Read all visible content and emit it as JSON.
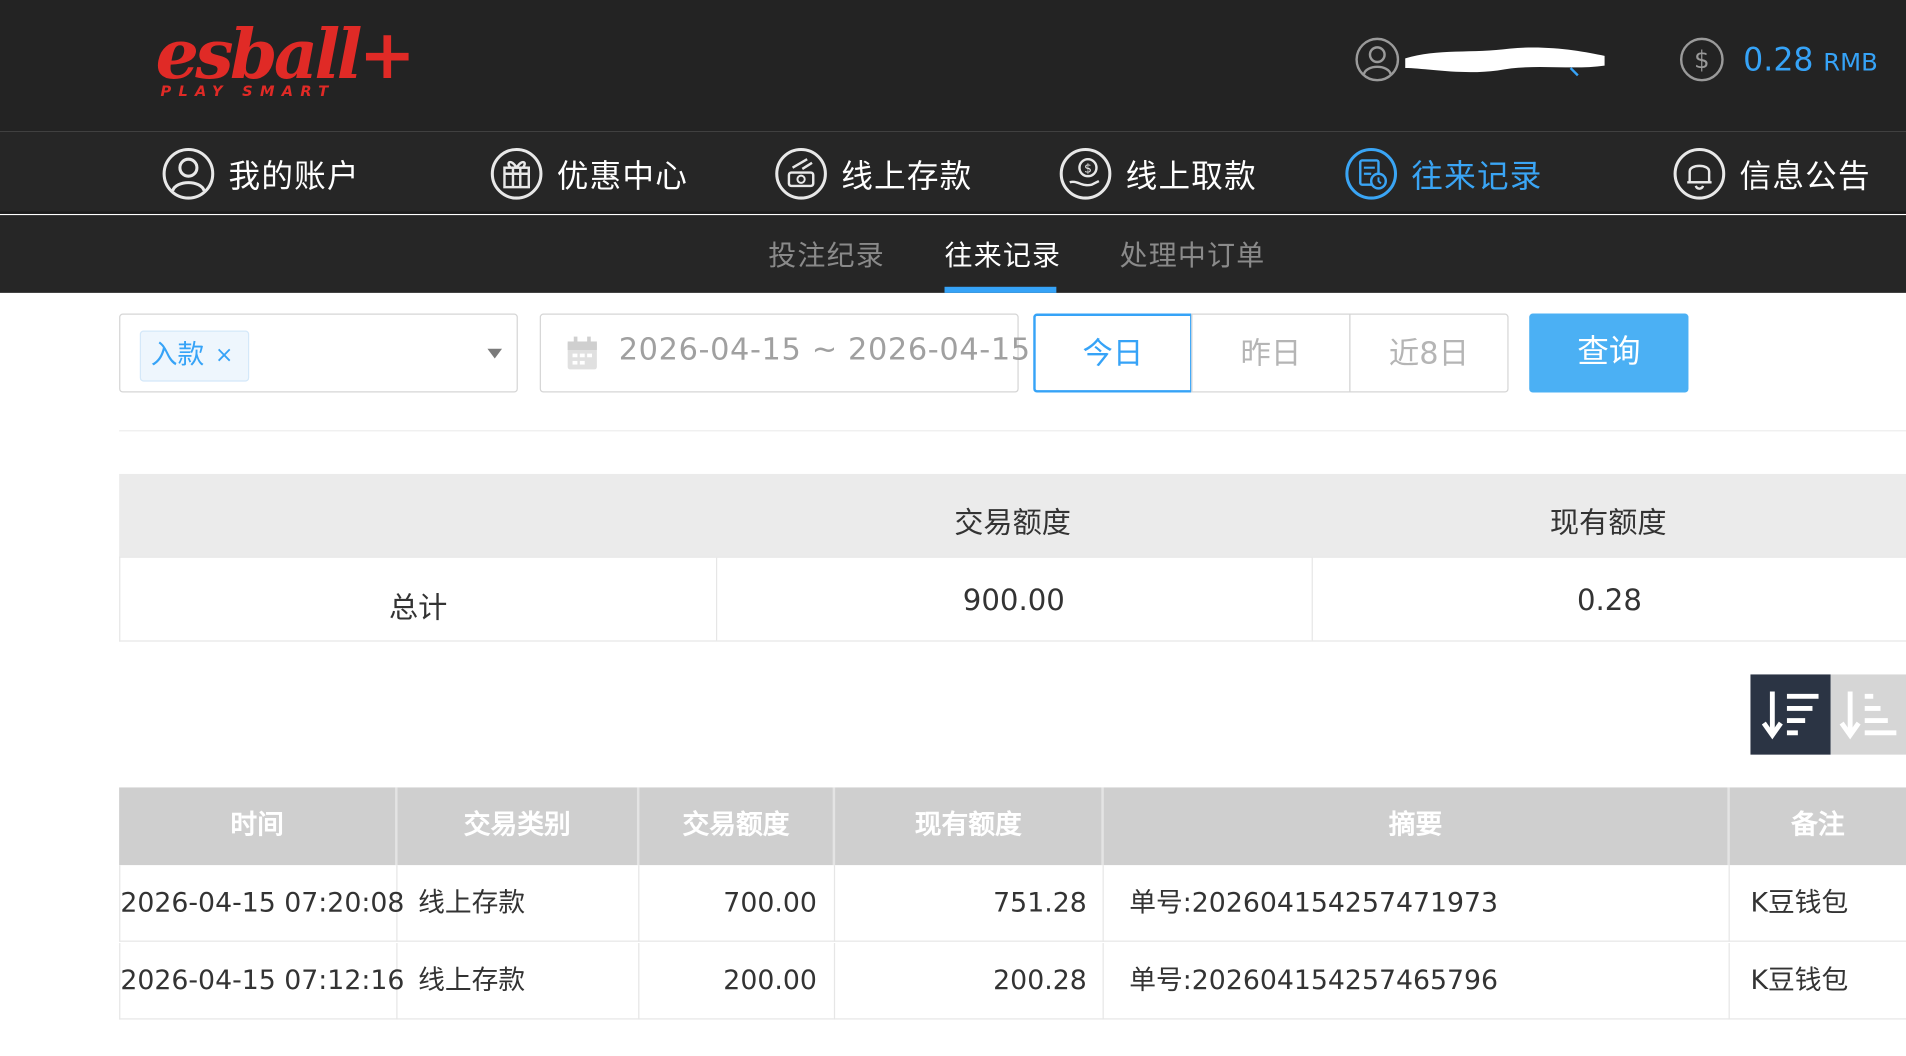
{
  "brand": {
    "name": "esball+",
    "tagline": "PLAY SMART"
  },
  "account": {
    "balance": "0.28",
    "currency": "RMB"
  },
  "nav": [
    {
      "label": "我的账户",
      "icon": "user-circle-icon"
    },
    {
      "label": "优惠中心",
      "icon": "gift-icon"
    },
    {
      "label": "线上存款",
      "icon": "deposit-icon"
    },
    {
      "label": "线上取款",
      "icon": "withdraw-icon"
    },
    {
      "label": "往来记录",
      "icon": "records-icon",
      "active": true
    },
    {
      "label": "信息公告",
      "icon": "bell-icon"
    }
  ],
  "subnav": [
    {
      "label": "投注纪录"
    },
    {
      "label": "往来记录",
      "active": true
    },
    {
      "label": "处理中订单"
    }
  ],
  "filters": {
    "type_chip": "入款",
    "chip_close": "×",
    "date_range": "2026-04-15 ~ 2026-04-15",
    "quick": [
      "今日",
      "昨日",
      "近8日"
    ],
    "quick_selected": "今日",
    "query": "查询"
  },
  "summary": {
    "headers": [
      "",
      "交易额度",
      "现有额度"
    ],
    "row": [
      "总计",
      "900.00",
      "0.28"
    ]
  },
  "records": {
    "headers": [
      "时间",
      "交易类别",
      "交易额度",
      "现有额度",
      "摘要",
      "备注"
    ],
    "rows": [
      [
        "2026-04-15 07:20:08",
        "线上存款",
        "700.00",
        "751.28",
        "单号:202604154257471973",
        "K豆钱包"
      ],
      [
        "2026-04-15 07:12:16",
        "线上存款",
        "200.00",
        "200.28",
        "单号:202604154257465796",
        "K豆钱包"
      ]
    ]
  },
  "colors": {
    "accent": "#36a3f7",
    "topbar": "#232323",
    "brand_red": "#e02a26"
  }
}
